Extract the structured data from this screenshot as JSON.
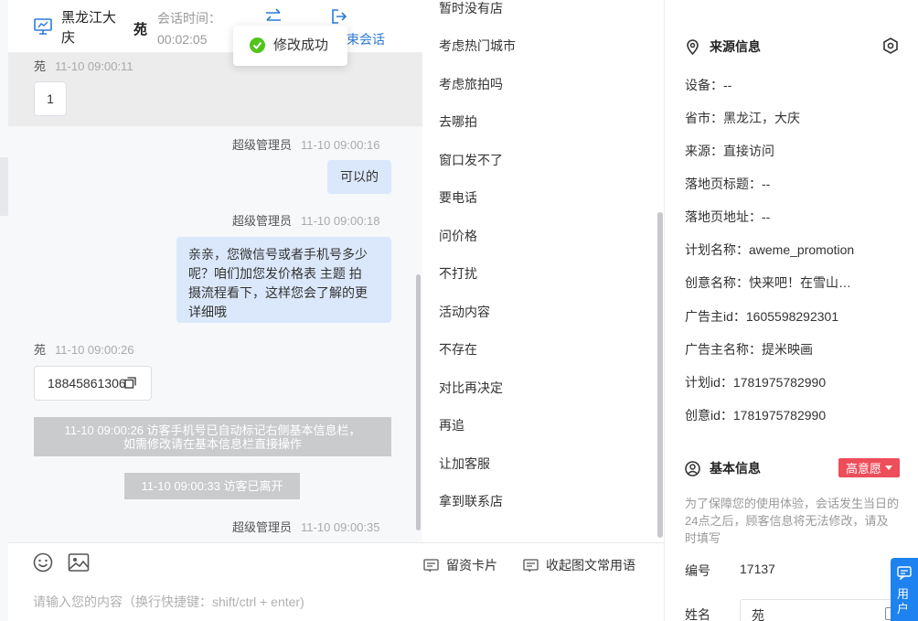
{
  "header": {
    "location": "黑龙江大庆",
    "visitor_name": "苑",
    "session_time_label": "会话时间：",
    "session_time_value": "00:02:05",
    "end_session_label": "束会话",
    "icons": [
      "monitor-icon",
      "transfer-icon",
      "end-session-icon"
    ]
  },
  "toast": {
    "text": "修改成功",
    "icon": "check-circle-icon",
    "color": "#52c41a"
  },
  "messages": [
    {
      "sender": "苑",
      "time": "11-10 09:00:11",
      "text": "1",
      "side": "left"
    },
    {
      "sender": "超级管理员",
      "time": "11-10 09:00:16",
      "text": "可以的",
      "side": "right"
    },
    {
      "sender": "超级管理员",
      "time": "11-10 09:00:18",
      "lines": [
        "亲亲，您微信号或者手机号多少",
        "呢？咱们加您发价格表 主题 拍",
        "摄流程看下，这样您会了解的更",
        "详细哦"
      ],
      "side": "right"
    },
    {
      "sender": "苑",
      "time": "11-10 09:00:26",
      "text": "18845861306",
      "side": "left"
    },
    {
      "sender": "超级管理员",
      "time": "11-10 09:00:35",
      "side": "right"
    }
  ],
  "system_notices": {
    "phone_tagged": [
      "11-10 09:00:26 访客手机号已自动标记右侧基本信息栏，",
      "如需修改请在基本信息栏直接操作"
    ],
    "visitor_left": "11-10 09:00:33 访客已离开"
  },
  "composer": {
    "placeholder": "请输入您的内容（换行快捷键：shift/ctrl + enter)",
    "lead_card_label": "留资卡片",
    "collapse_phrases_label": "收起图文常用语",
    "icons": [
      "emoji-icon",
      "image-icon",
      "card-icon",
      "phrases-icon"
    ]
  },
  "phrases": [
    "暂时没有店",
    "考虑热门城市",
    "考虑旅拍吗",
    "去哪拍",
    "窗口发不了",
    "要电话",
    "问价格",
    "不打扰",
    "活动内容",
    "不存在",
    "对比再决定",
    "再追",
    "让加客服",
    "拿到联系店"
  ],
  "source_info": {
    "title": "来源信息",
    "rows": [
      "设备：--",
      "省市：黑龙江，大庆",
      "来源：直接访问",
      "落地页标题：--",
      "落地页地址：--",
      "计划名称：aweme_promotion",
      "创意名称：快来吧！在雪山下拍摄",
      "广告主id：1605598292301",
      "广告主名称：提米映画",
      "计划id：1781975782990",
      "创意id：1781975782990"
    ]
  },
  "basic_info": {
    "title": "基本信息",
    "intent_label": "高意愿",
    "intent_color": "#ee4d5a",
    "notice": "为了保障您的使用体验，会话发生当日的24点之后，顾客信息将无法修改，请及时填写",
    "id_label": "编号",
    "id_value": "17137",
    "name_label": "姓名",
    "name_value": "苑"
  },
  "user_tab": {
    "label": "用户"
  },
  "colors": {
    "accent": "#2b7bd8",
    "bubble_blue": "#dbe8fb",
    "tab_blue": "#1e82f0"
  }
}
